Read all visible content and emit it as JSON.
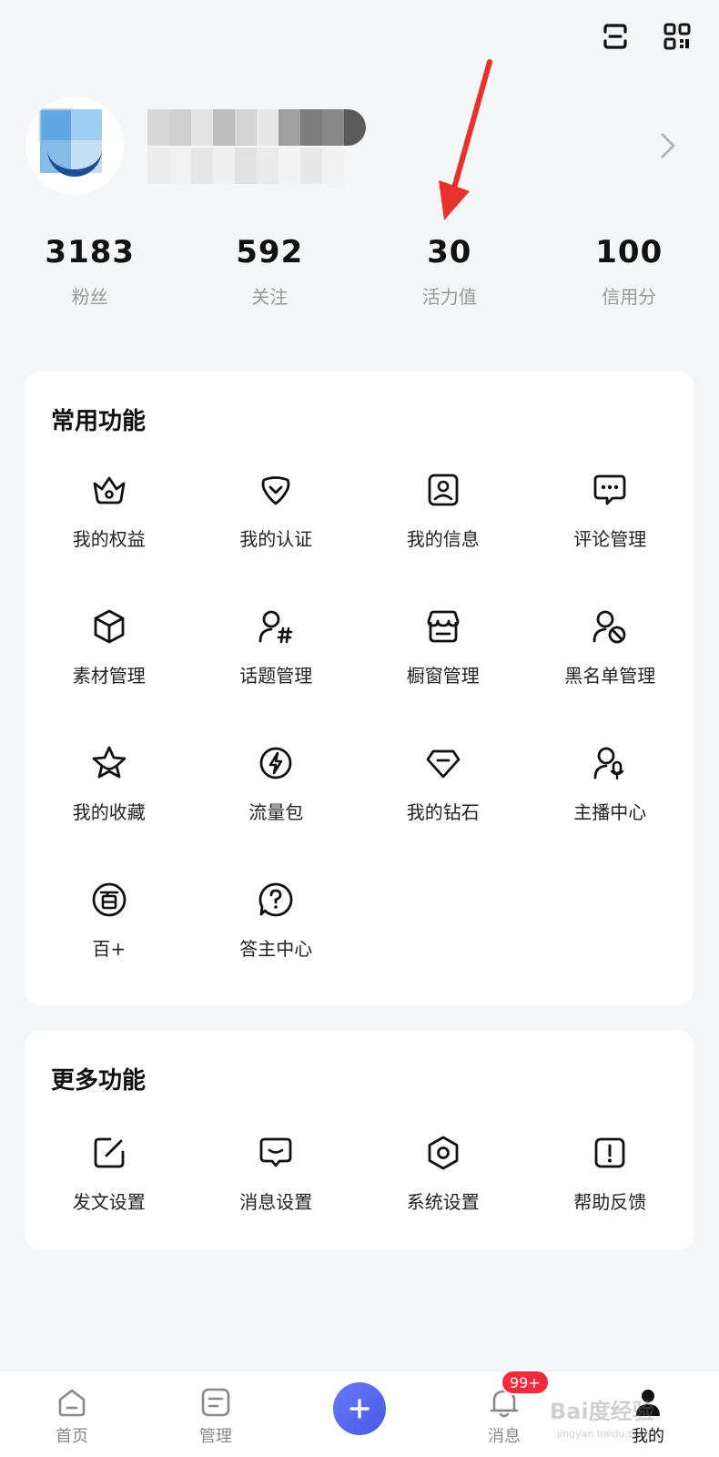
{
  "header": {
    "icons": [
      "scan-icon",
      "qr-code-icon"
    ]
  },
  "stats": [
    {
      "value": "3183",
      "label": "粉丝"
    },
    {
      "value": "592",
      "label": "关注"
    },
    {
      "value": "30",
      "label": "活力值"
    },
    {
      "value": "100",
      "label": "信用分"
    }
  ],
  "common": {
    "title": "常用功能",
    "items": [
      {
        "label": "我的权益",
        "icon": "crown-icon"
      },
      {
        "label": "我的认证",
        "icon": "certification-icon"
      },
      {
        "label": "我的信息",
        "icon": "profile-card-icon"
      },
      {
        "label": "评论管理",
        "icon": "comment-icon"
      },
      {
        "label": "素材管理",
        "icon": "cube-icon"
      },
      {
        "label": "话题管理",
        "icon": "topic-icon"
      },
      {
        "label": "橱窗管理",
        "icon": "shop-icon"
      },
      {
        "label": "黑名单管理",
        "icon": "block-user-icon"
      },
      {
        "label": "我的收藏",
        "icon": "star-icon"
      },
      {
        "label": "流量包",
        "icon": "lightning-icon"
      },
      {
        "label": "我的钻石",
        "icon": "diamond-icon"
      },
      {
        "label": "主播中心",
        "icon": "anchor-icon"
      },
      {
        "label": "百+",
        "icon": "bai-plus-icon"
      },
      {
        "label": "答主中心",
        "icon": "question-icon"
      }
    ]
  },
  "more": {
    "title": "更多功能",
    "items": [
      {
        "label": "发文设置",
        "icon": "edit-icon"
      },
      {
        "label": "消息设置",
        "icon": "message-icon"
      },
      {
        "label": "系统设置",
        "icon": "settings-hex-icon"
      },
      {
        "label": "帮助反馈",
        "icon": "feedback-icon"
      }
    ]
  },
  "tabbar": {
    "home": "首页",
    "manage": "管理",
    "messages": "消息",
    "mine": "我的",
    "badge": "99+"
  },
  "watermark": {
    "text": "Bai度经验",
    "sub": "jingyan.baidu.com"
  },
  "colors": {
    "accent": "#4759e8",
    "badge": "#f2283d",
    "arrow": "#e8312b"
  }
}
